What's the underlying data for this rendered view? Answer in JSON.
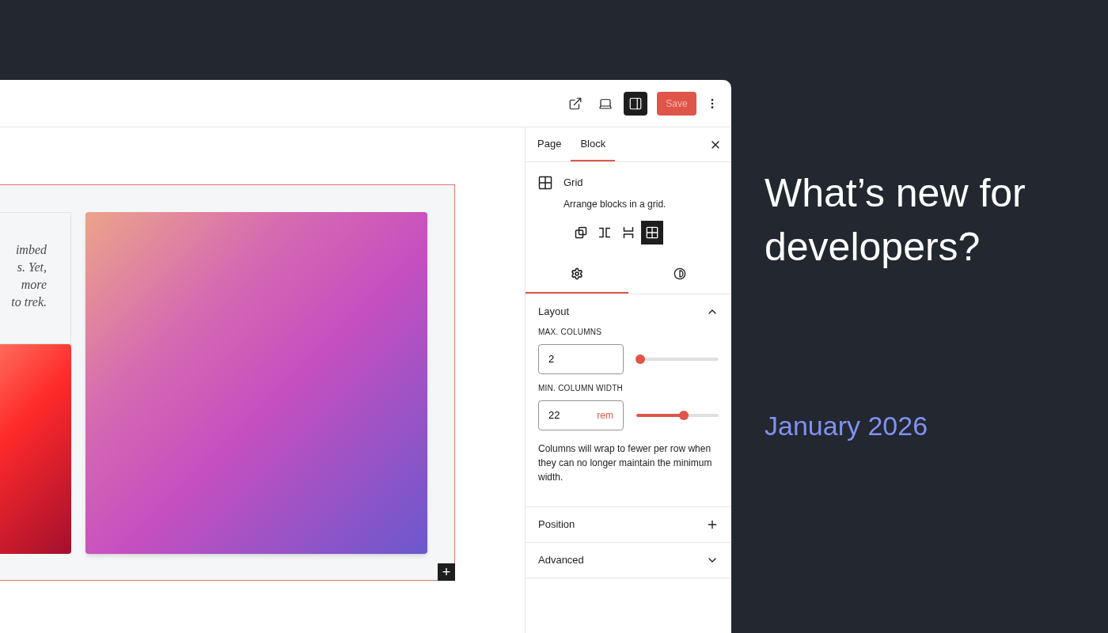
{
  "toolbar": {
    "view_buttons": [
      {
        "kind": "external",
        "selected": false
      },
      {
        "kind": "laptop",
        "selected": false
      },
      {
        "kind": "sidebar",
        "selected": true
      }
    ],
    "save": {
      "label": "Save",
      "disabled": true
    }
  },
  "canvas": {
    "paragraph_lines": [
      "imbed",
      "s. Yet,",
      "more",
      "to trek."
    ],
    "add_label": "+"
  },
  "sidebar": {
    "tabs": [
      {
        "label": "Page",
        "selected": false
      },
      {
        "label": "Block",
        "selected": true
      }
    ],
    "block": {
      "name": "Grid",
      "description": "Arrange blocks in a grid.",
      "variations": [
        {
          "kind": "group",
          "selected": false
        },
        {
          "kind": "row",
          "selected": false
        },
        {
          "kind": "stack",
          "selected": false
        },
        {
          "kind": "grid",
          "selected": true
        }
      ]
    },
    "subtabs": [
      {
        "kind": "settings",
        "selected": true
      },
      {
        "kind": "styles",
        "selected": false
      }
    ],
    "panels": [
      {
        "title": "Layout",
        "expanded": true,
        "kind": "chevron",
        "controls": [
          {
            "label": "MAX. COLUMNS",
            "value": "2",
            "level": 0.05
          },
          {
            "label": "MIN. COLUMN WIDTH",
            "value": "22",
            "unit": "rem",
            "level": 0.58
          }
        ],
        "help": "Columns will wrap to fewer per row when they can no longer maintain the minimum width."
      },
      {
        "title": "Position",
        "expanded": false,
        "kind": "plus"
      },
      {
        "title": "Advanced",
        "expanded": false,
        "kind": "chevron"
      }
    ]
  },
  "promo": {
    "title": "What’s new for developers?",
    "date": "January 2026"
  }
}
